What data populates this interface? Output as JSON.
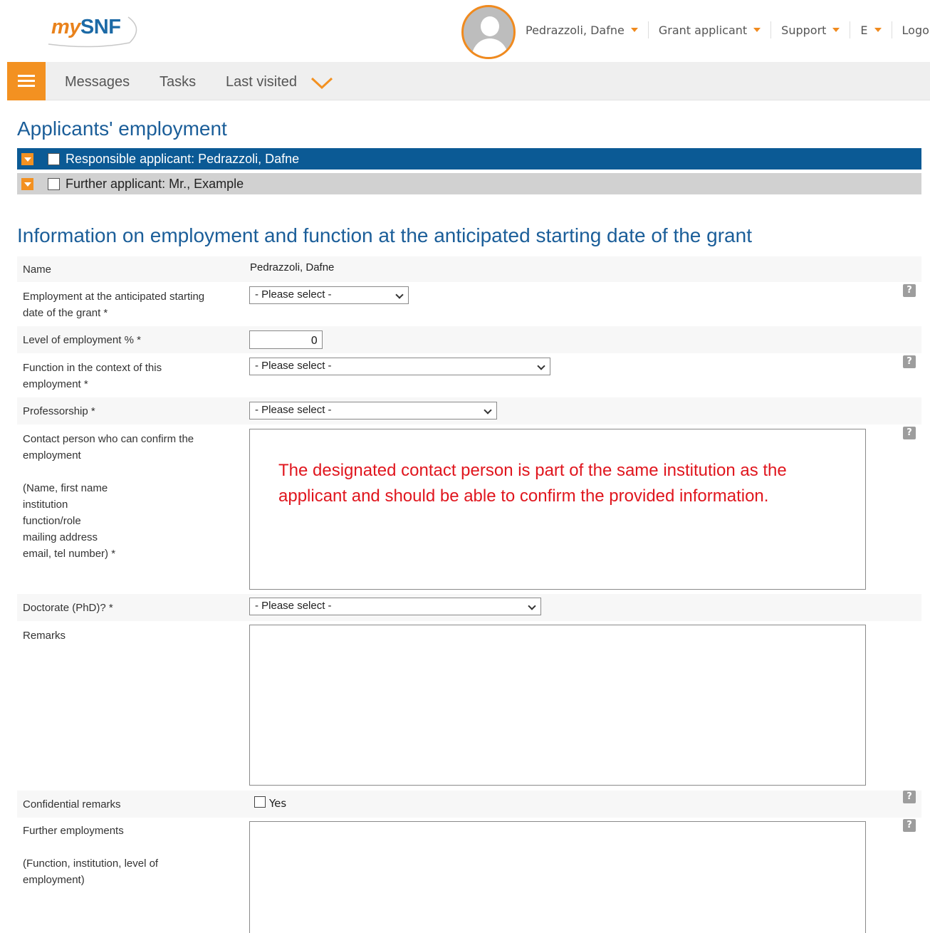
{
  "header": {
    "logo_my": "my",
    "logo_snf": "SNF",
    "user_menu": "Pedrazzoli, Dafne",
    "role_menu": "Grant applicant",
    "support_menu": "Support",
    "language_menu": "E",
    "logout": "Logou"
  },
  "menubar": {
    "messages": "Messages",
    "tasks": "Tasks",
    "last_visited": "Last visited"
  },
  "page_title": "Applicants' employment",
  "applicants": [
    {
      "label": "Responsible applicant: Pedrazzoli, Dafne",
      "active": true
    },
    {
      "label": "Further applicant: Mr., Example",
      "active": false
    }
  ],
  "section_title": "Information on employment and function at the anticipated starting date of the grant",
  "form": {
    "name_label": "Name",
    "name_value": "Pedrazzoli, Dafne",
    "employment_label_1": "Employment at the anticipated starting",
    "employment_label_2": "date of the grant *",
    "employment_value": "- Please select -",
    "level_label": "Level of employment % *",
    "level_value": "0",
    "function_label_1": "Function in the context of this",
    "function_label_2": "employment *",
    "function_value": "- Please select -",
    "professorship_label": "Professorship *",
    "professorship_value": "- Please select -",
    "contact_label_1": "Contact person who can confirm the",
    "contact_label_2": "employment",
    "contact_label_3": "(Name, first name",
    "contact_label_4": "institution",
    "contact_label_5": "function/role",
    "contact_label_6": "mailing address",
    "contact_label_7": "email, tel number) *",
    "contact_note": "The designated contact person is part of the same institution as the applicant and should be able to confirm the provided information.",
    "doctorate_label": "Doctorate (PhD)? *",
    "doctorate_value": "- Please select -",
    "remarks_label": "Remarks",
    "confidential_label": "Confidential remarks",
    "confidential_option": "Yes",
    "further_label_1": "Further employments",
    "further_label_2": "(Function, institution, level of",
    "further_label_3": "employment)",
    "help_glyph": "?"
  },
  "colors": {
    "brand_orange": "#f39121",
    "brand_blue": "#0b5a95",
    "title_blue": "#1b5e99",
    "note_red": "#e0161e"
  }
}
